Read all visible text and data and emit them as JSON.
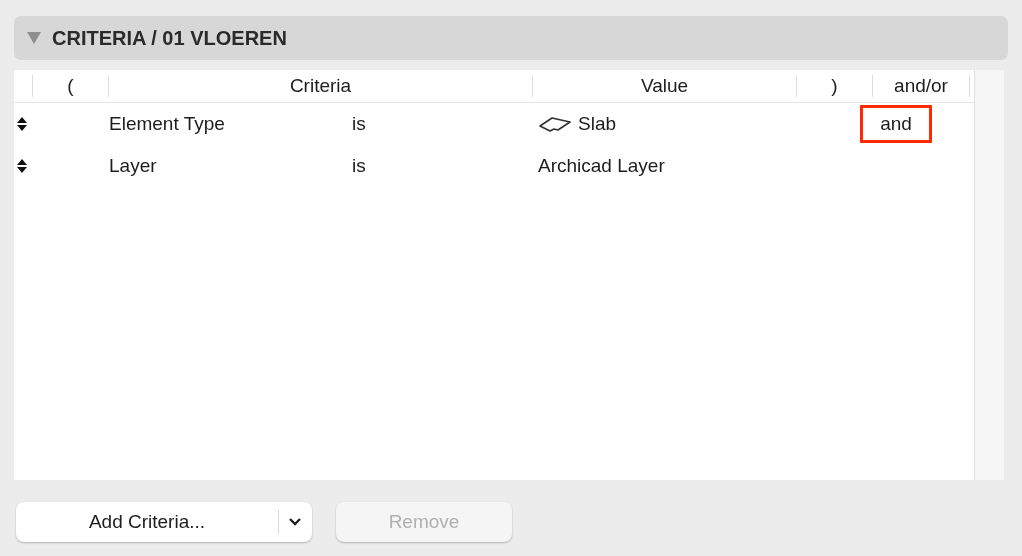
{
  "panel": {
    "title": "CRITERIA / 01 VLOEREN",
    "expanded": true
  },
  "table": {
    "columns": [
      "(",
      "Criteria",
      "Value",
      ")",
      "and/or"
    ],
    "rows": [
      {
        "criteria": "Element Type",
        "operator": "is",
        "value": "Slab",
        "kind": "slab",
        "and_or": "and",
        "highlighted": true
      },
      {
        "criteria": "Layer",
        "operator": "is",
        "value": "Archicad Layer",
        "kind": "text",
        "highlighted": false
      }
    ]
  },
  "buttons": [
    {
      "label": "Add Criteria...",
      "kind": "split",
      "disabled": false
    },
    {
      "label": "Remove",
      "kind": "plain",
      "disabled": true
    }
  ]
}
